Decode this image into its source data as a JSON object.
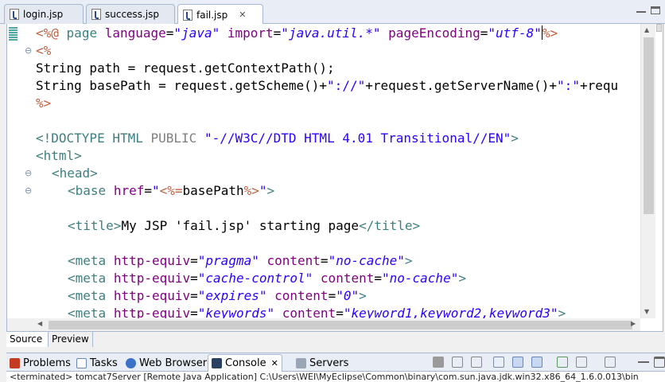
{
  "editor_tabs": [
    {
      "label": "login.jsp"
    },
    {
      "label": "success.jsp"
    },
    {
      "label": "fail.jsp",
      "close": "✕"
    }
  ],
  "code": {
    "line1": {
      "d1": "<%@",
      "kw": "page",
      "a1": "language",
      "eq1": "=",
      "v1": "\"java\"",
      "a2": "import",
      "eq2": "=",
      "v2": "\"java.util.*\"",
      "a3": "pageEncoding",
      "eq3": "=",
      "v3": "\"utf-8\"",
      "d2": "%>"
    },
    "line2": "<%",
    "line3": "String path = request.getContextPath();",
    "line4": {
      "p1": "String basePath = request.getScheme()+",
      "s1": "\"://\"",
      "p2": "+request.getServerName()+",
      "s2": "\":\"",
      "p3": "+requ"
    },
    "line5": "%>",
    "line7": {
      "t1": "<!DOCTYPE HTML",
      "g1": "PUBLIC",
      "s1": "\"-//W3C//DTD HTML 4.01 Transitional//EN\"",
      "t2": ">"
    },
    "line8": "<html>",
    "line9": "<head>",
    "line10": {
      "t1": "<base",
      "a1": "href",
      "eq": "=",
      "s1": "\"",
      "d1": "<%=",
      "k1": "basePath",
      "d2": "%>",
      "s2": "\"",
      "t2": ">"
    },
    "line12": {
      "t1": "<title>",
      "k1": "My JSP 'fail.jsp' starting page",
      "t2": "</title>"
    },
    "line14": {
      "t1": "<meta",
      "a1": "http-equiv",
      "eq1": "=",
      "v1": "\"pragma\"",
      "a2": "content",
      "eq2": "=",
      "v2": "\"no-cache\"",
      "t2": ">"
    },
    "line15": {
      "t1": "<meta",
      "a1": "http-equiv",
      "eq1": "=",
      "v1": "\"cache-control\"",
      "a2": "content",
      "eq2": "=",
      "v2": "\"no-cache\"",
      "t2": ">"
    },
    "line16": {
      "t1": "<meta",
      "a1": "http-equiv",
      "eq1": "=",
      "v1": "\"expires\"",
      "a2": "content",
      "eq2": "=",
      "v2": "\"0\"",
      "t2": ">"
    },
    "line17": {
      "t1": "<meta",
      "a1": "http-equiv",
      "eq1": "=",
      "v1": "\"keywords\"",
      "a2": "content",
      "eq2": "=",
      "v2": "\"keyword1,keyword2,keyword3\"",
      "t2": ">"
    }
  },
  "source_tabs": [
    {
      "label": "Source"
    },
    {
      "label": "Preview"
    }
  ],
  "views": [
    {
      "label": "Problems"
    },
    {
      "label": "Tasks"
    },
    {
      "label": "Web Browser"
    },
    {
      "label": "Console",
      "close": "✕"
    },
    {
      "label": "Servers"
    }
  ],
  "status_text": "<terminated> tomcat7Server [Remote Java Application] C:\\Users\\WEI\\MyEclipse\\Common\\binary\\com.sun.java.jdk.win32.x86_64_1.6.0.013\\bin",
  "colors": {
    "directive": "#bf5f3f",
    "tag": "#3f7f7f",
    "attr": "#7f007f",
    "value": "#2a00ff"
  },
  "fold_markers": [
    "⊖",
    "⊖",
    "⊖"
  ],
  "icons": [
    "jsp-file-icon",
    "problems-icon",
    "tasks-icon",
    "web-browser-icon",
    "console-icon",
    "servers-icon"
  ]
}
